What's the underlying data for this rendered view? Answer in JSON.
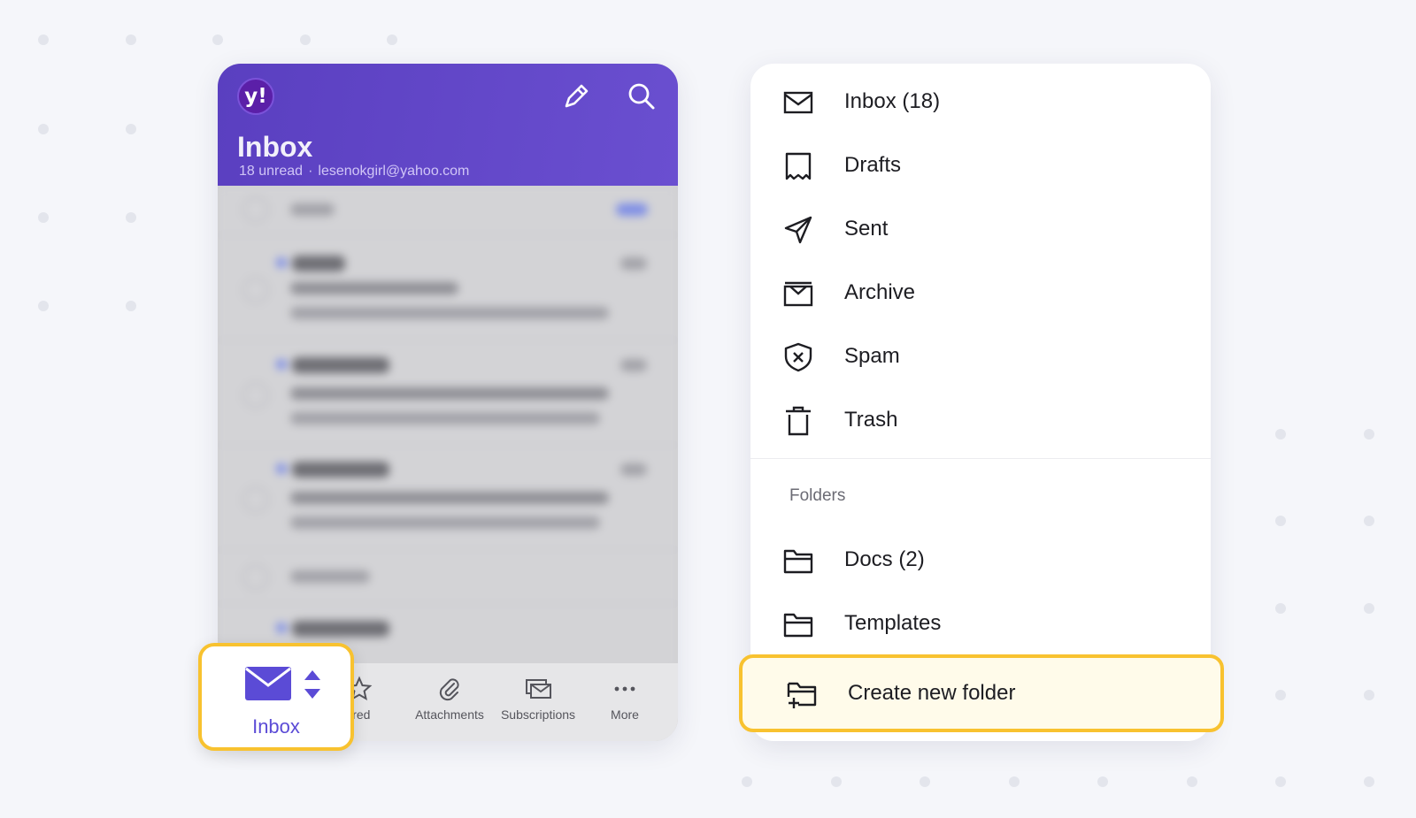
{
  "header": {
    "logo_text": "y!",
    "title": "Inbox",
    "unread": "18 unread",
    "separator": "·",
    "email": "lesenokgirl@yahoo.com"
  },
  "tabbar": {
    "starred": "rred",
    "attachments": "Attachments",
    "subscriptions": "Subscriptions",
    "more": "More"
  },
  "inbox_selector": {
    "label": "Inbox"
  },
  "menu": {
    "items": [
      {
        "label": "Inbox (18)",
        "icon": "envelope-icon"
      },
      {
        "label": "Drafts",
        "icon": "drafts-icon"
      },
      {
        "label": "Sent",
        "icon": "send-icon"
      },
      {
        "label": "Archive",
        "icon": "archive-icon"
      },
      {
        "label": "Spam",
        "icon": "shield-x-icon"
      },
      {
        "label": "Trash",
        "icon": "trash-icon"
      }
    ],
    "folders_label": "Folders",
    "folders": [
      {
        "label": "Docs (2)",
        "icon": "folder-icon"
      },
      {
        "label": "Templates",
        "icon": "folder-icon"
      }
    ],
    "create_folder": {
      "label": "Create new folder",
      "icon": "folder-plus-icon"
    }
  },
  "colors": {
    "header_purple": "#6a4fd0",
    "accent_yellow": "#f8c22f",
    "inbox_label": "#5b4bd6"
  }
}
